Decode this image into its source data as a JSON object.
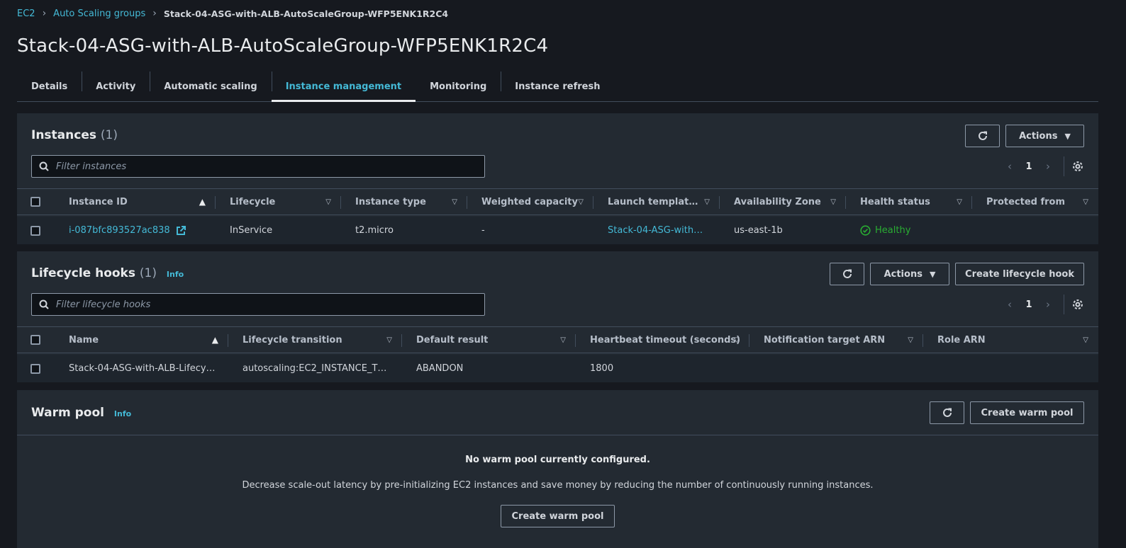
{
  "breadcrumb": {
    "home": "EC2",
    "section": "Auto Scaling groups",
    "current": "Stack-04-ASG-with-ALB-AutoScaleGroup-WFP5ENK1R2C4"
  },
  "page_title": "Stack-04-ASG-with-ALB-AutoScaleGroup-WFP5ENK1R2C4",
  "tabs": [
    "Details",
    "Activity",
    "Automatic scaling",
    "Instance management",
    "Monitoring",
    "Instance refresh"
  ],
  "active_tab": "Instance management",
  "instances": {
    "title": "Instances",
    "count": "(1)",
    "actions_label": "Actions",
    "search_placeholder": "Filter instances",
    "page": "1",
    "columns": [
      "Instance ID",
      "Lifecycle",
      "Instance type",
      "Weighted capacity",
      "Launch templat…",
      "Availability Zone",
      "Health status",
      "Protected from"
    ],
    "rows": [
      {
        "instance_id": "i-087bfc893527ac838",
        "lifecycle": "InService",
        "type": "t2.micro",
        "weighted": "-",
        "launch_template": "Stack-04-ASG-with…",
        "az": "us-east-1b",
        "health": "Healthy",
        "protected": ""
      }
    ]
  },
  "hooks": {
    "title": "Lifecycle hooks",
    "count": "(1)",
    "info": "Info",
    "actions_label": "Actions",
    "create_label": "Create lifecycle hook",
    "search_placeholder": "Filter lifecycle hooks",
    "page": "1",
    "columns": [
      "Name",
      "Lifecycle transition",
      "Default result",
      "Heartbeat timeout (seconds)",
      "Notification target ARN",
      "Role ARN"
    ],
    "rows": [
      {
        "name": "Stack-04-ASG-with-ALB-Lifecy…",
        "transition": "autoscaling:EC2_INSTANCE_T…",
        "default_result": "ABANDON",
        "heartbeat": "1800",
        "notification": "",
        "role": ""
      }
    ]
  },
  "warm_pool": {
    "title": "Warm pool",
    "info": "Info",
    "create_label": "Create warm pool",
    "empty_title": "No warm pool currently configured.",
    "empty_desc": "Decrease scale-out latency by pre-initializing EC2 instances and save money by reducing the number of continuously running instances.",
    "empty_button": "Create warm pool"
  }
}
